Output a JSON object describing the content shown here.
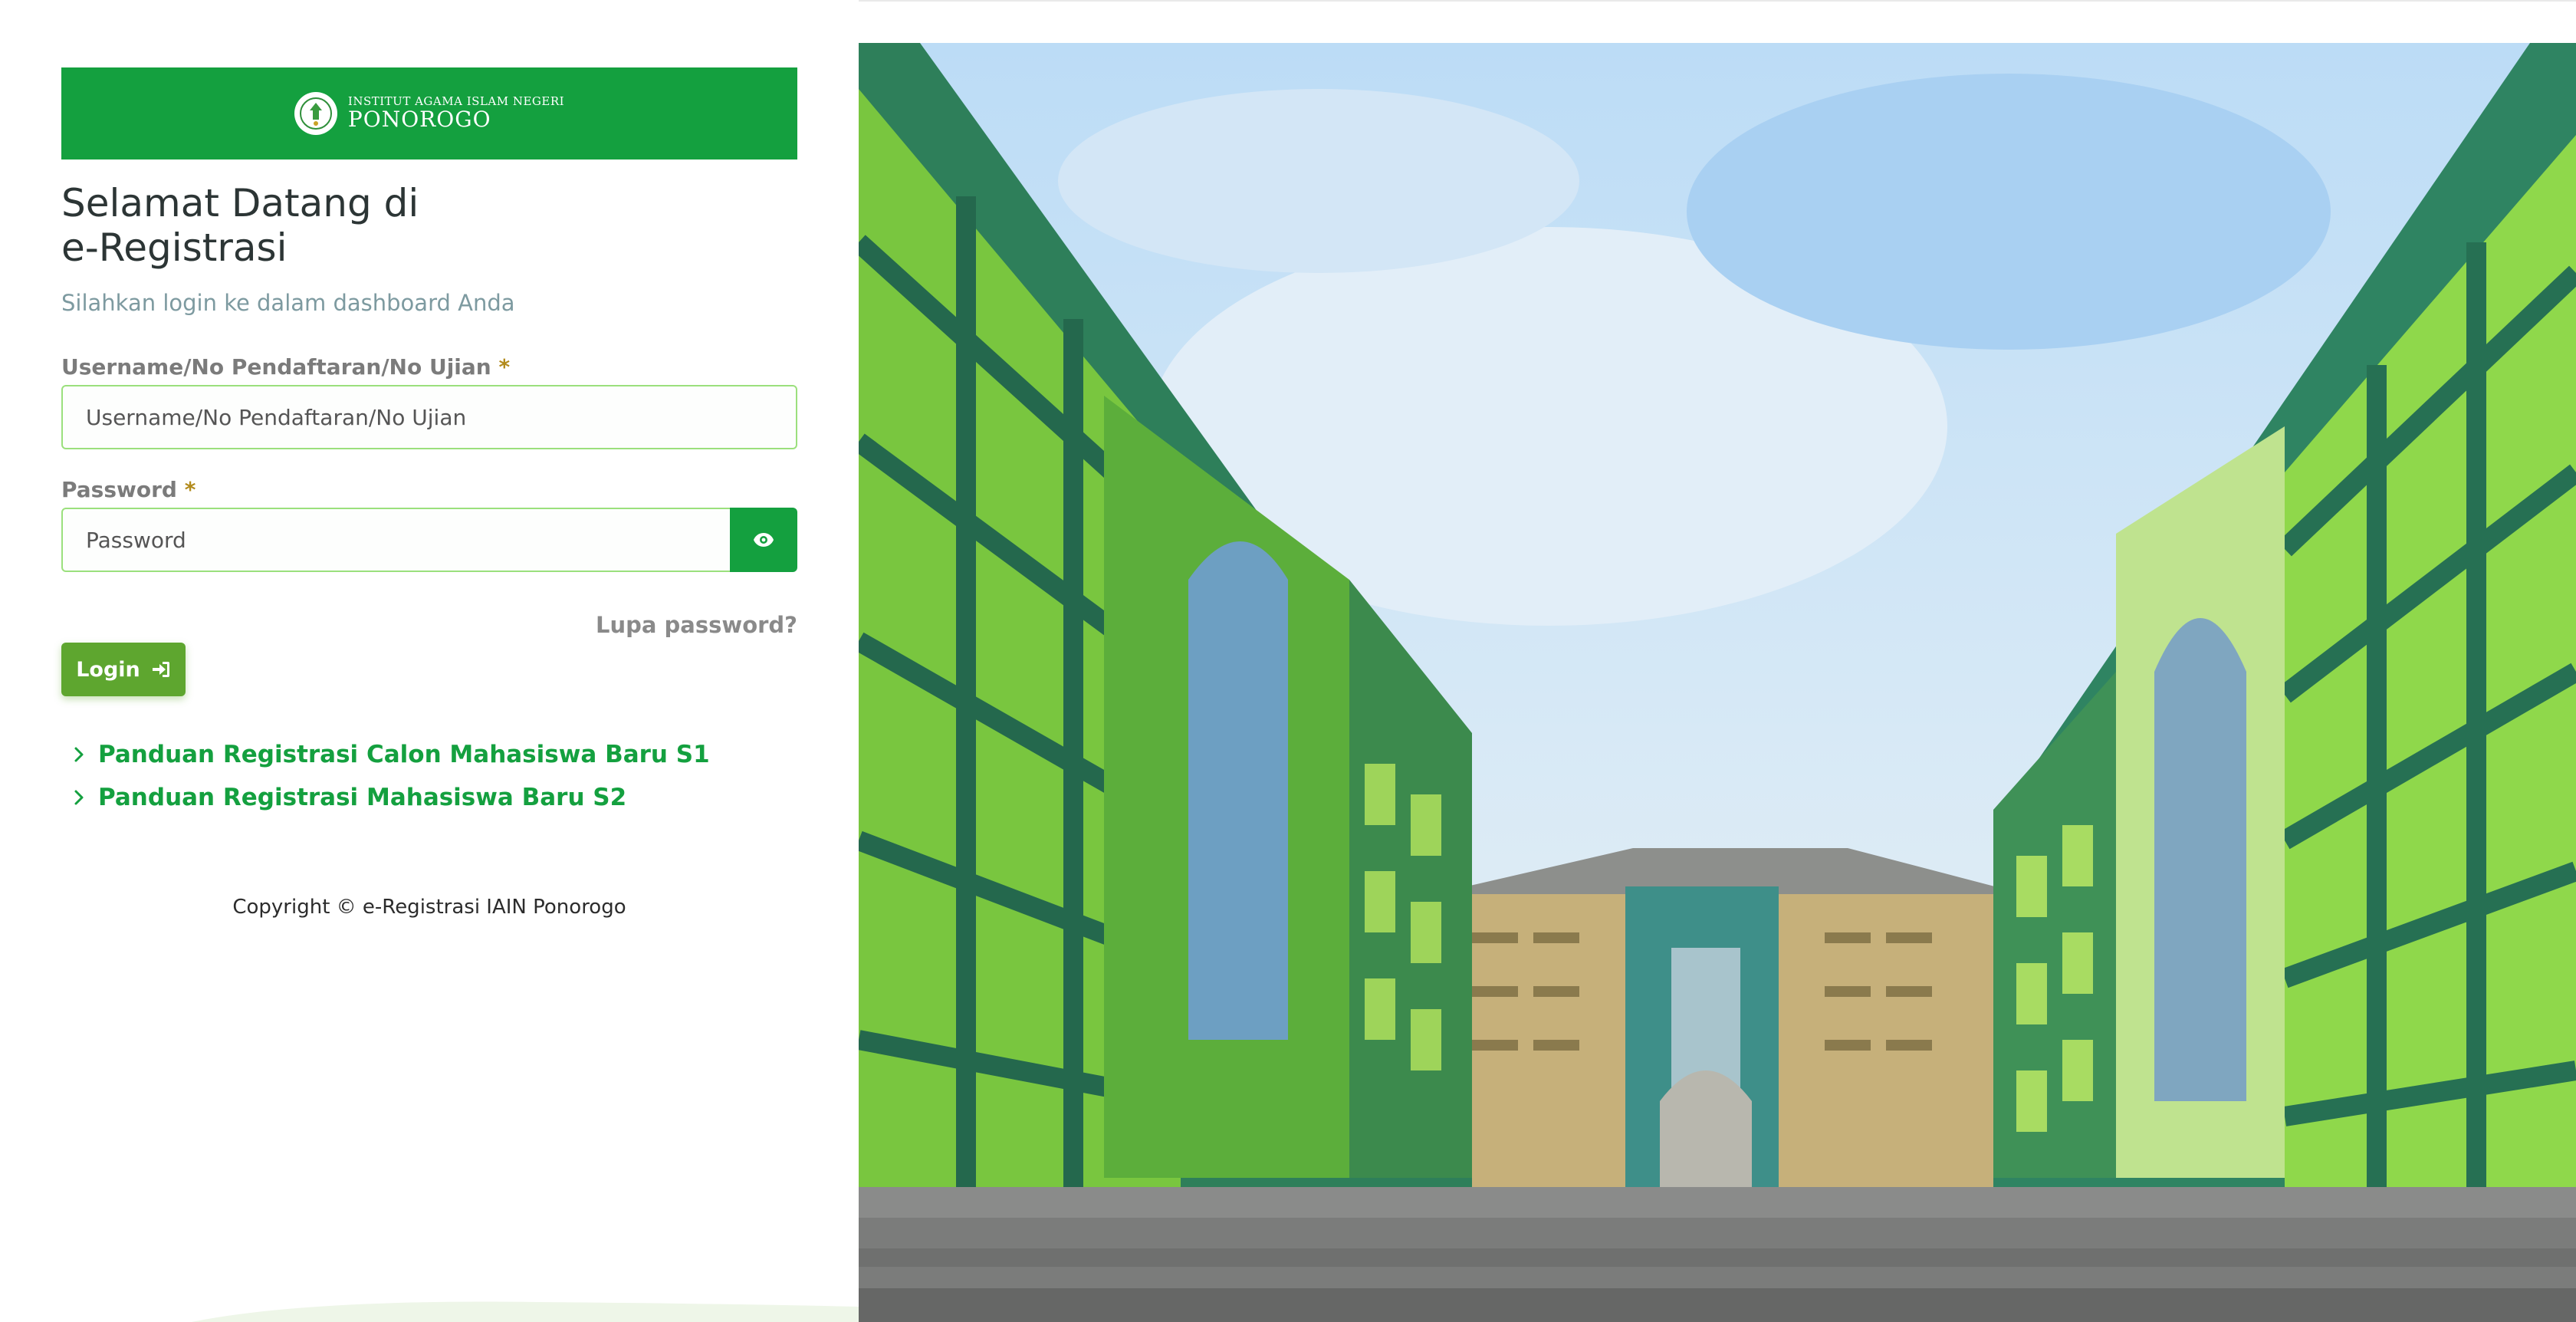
{
  "brand": {
    "institution_top": "INSTITUT AGAMA ISLAM NEGERI",
    "institution_name": "PONOROGO"
  },
  "welcome": {
    "line1": "Selamat Datang di",
    "line2": "e-Registrasi",
    "subtitle": "Silahkan login ke dalam dashboard Anda"
  },
  "form": {
    "username_label": "Username/No Pendaftaran/No Ujian",
    "username_placeholder": "Username/No Pendaftaran/No Ujian",
    "password_label": "Password",
    "password_placeholder": "Password",
    "required_mark": "*",
    "forgot_label": "Lupa password?",
    "login_label": "Login"
  },
  "guides": [
    {
      "label": "Panduan Registrasi Calon Mahasiswa Baru S1"
    },
    {
      "label": "Panduan Registrasi Mahasiswa Baru S2"
    }
  ],
  "footer": {
    "copyright": "Copyright © e-Registrasi IAIN Ponorogo"
  },
  "colors": {
    "brand_green": "#14a03f",
    "login_green": "#5ea62f",
    "input_border": "#9be07d",
    "required": "#b28b1d"
  },
  "icons": {
    "eye": "eye-icon",
    "login": "sign-in-icon",
    "chevron": "chevron-right-icon",
    "logo": "iain-logo"
  }
}
